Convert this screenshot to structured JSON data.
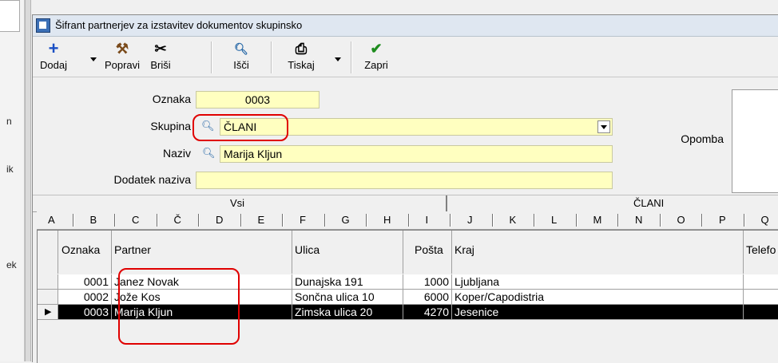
{
  "background_app": {
    "fragments": [
      "n",
      "ik",
      "ek"
    ]
  },
  "window": {
    "title": "Šifrant partnerjev za izstavitev dokumentov skupinsko"
  },
  "toolbar": {
    "add": "Dodaj",
    "edit": "Popravi",
    "delete": "Briši",
    "search": "Išči",
    "print": "Tiskaj",
    "close": "Zapri"
  },
  "form": {
    "oznaka_label": "Oznaka",
    "oznaka_value": "0003",
    "skupina_label": "Skupina",
    "skupina_value": "ČLANI",
    "naziv_label": "Naziv",
    "naziv_value": "Marija Kljun",
    "dodatek_label": "Dodatek naziva",
    "dodatek_value": "",
    "opomba_label": "Opomba"
  },
  "tabs": [
    "Vsi",
    "ČLANI"
  ],
  "alphabet": [
    "A",
    "B",
    "C",
    "Č",
    "D",
    "E",
    "F",
    "G",
    "H",
    "I",
    "J",
    "K",
    "L",
    "M",
    "N",
    "O",
    "P",
    "Q"
  ],
  "grid": {
    "columns": [
      "Oznaka",
      "Partner",
      "Ulica",
      "Pošta",
      "Kraj",
      "Telefo"
    ],
    "rows": [
      {
        "oznaka": "0001",
        "partner": "Janez Novak",
        "ulica": "Dunajska 191",
        "posta": "1000",
        "kraj": "Ljubljana"
      },
      {
        "oznaka": "0002",
        "partner": "Jože Kos",
        "ulica": "Sončna ulica 10",
        "posta": "6000",
        "kraj": "Koper/Capodistria"
      },
      {
        "oznaka": "0003",
        "partner": "Marija Kljun",
        "ulica": "Zimska ulica 20",
        "posta": "4270",
        "kraj": "Jesenice"
      }
    ],
    "selected_row": 2,
    "selector_glyph": "▶"
  },
  "colors": {
    "field_bg": "#ffffc0",
    "highlight": "#e00000",
    "selected_row": "#000000"
  }
}
